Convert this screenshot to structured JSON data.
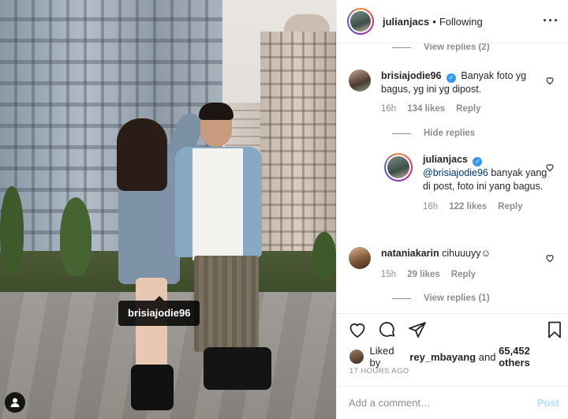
{
  "post": {
    "photo_tag": "brisiajodie96"
  },
  "header": {
    "username": "julianjacs",
    "separator": "•",
    "follow_status": "Following",
    "more": "···"
  },
  "comments": {
    "view_replies_top": "View replies (2)",
    "items": [
      {
        "username": "brisiajodie96",
        "text": "Banyak foto yg bagus, yg ini yg dipost.",
        "time": "16h",
        "likes": "134 likes",
        "reply": "Reply"
      },
      {
        "username": "nataniakarin",
        "text": "cihuuuyy☺",
        "time": "15h",
        "likes": "29 likes",
        "reply": "Reply"
      }
    ],
    "hide_replies": "Hide replies",
    "reply": {
      "username": "julianjacs",
      "mention": "@brisiajodie96",
      "text": " banyak yang di post, foto ini yang bagus.",
      "time": "16h",
      "likes": "122 likes",
      "reply": "Reply"
    },
    "view_replies_bottom": "View replies (1)"
  },
  "actions": {
    "liked_prefix": "Liked by ",
    "liked_user": "rey_mbayang",
    "liked_mid": " and ",
    "liked_count": "65,452 others",
    "timestamp": "17 HOURS AGO"
  },
  "composer": {
    "placeholder": "Add a comment…",
    "post_label": "Post"
  },
  "colors": {
    "verified": "#3897f0",
    "post_disabled": "#b2dffc",
    "muted": "#8e8e8e",
    "mention": "#00376b"
  }
}
